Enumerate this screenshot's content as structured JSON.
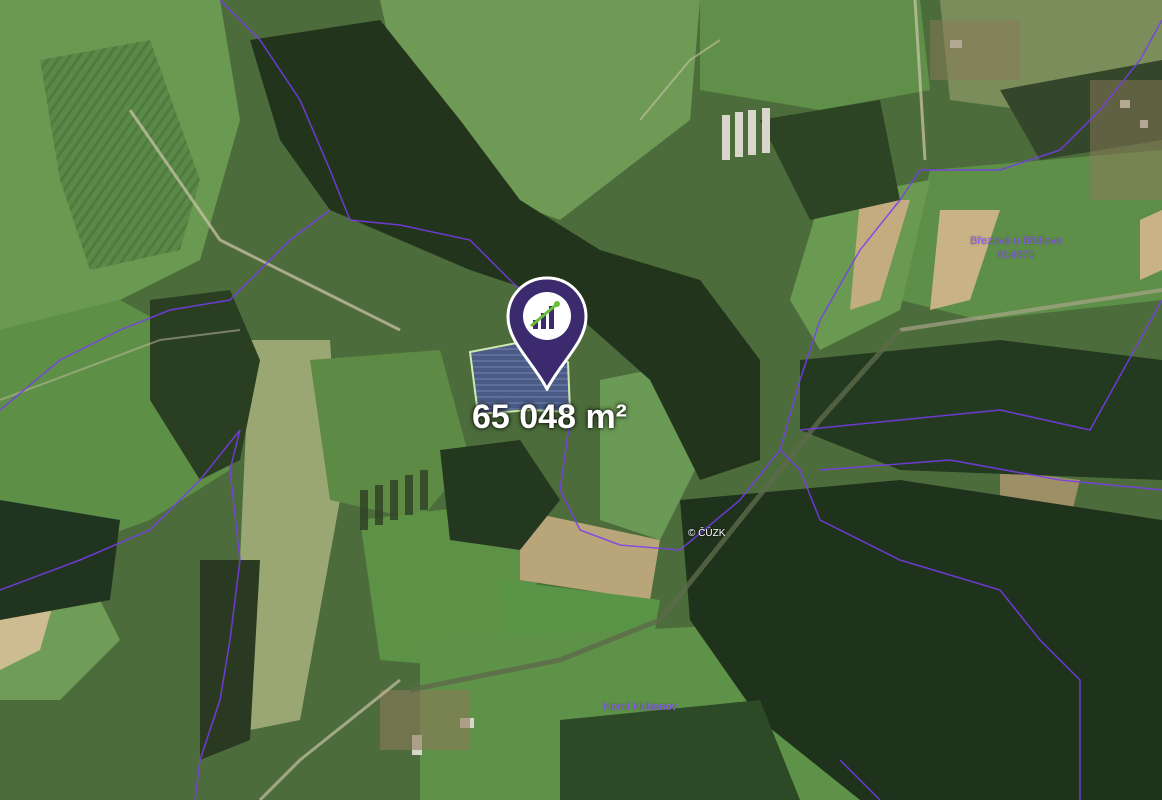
{
  "map": {
    "area_label": "65 048 m²",
    "place_labels": [
      {
        "name": "Březová u Břidlova",
        "code": "614670"
      },
      {
        "name": "Horní Hubenov",
        "code": ""
      }
    ],
    "attribution": "© ČÚZK",
    "marker_icon": "chart-bars-icon",
    "colors": {
      "boundary": "#7a3cf0",
      "parcel_outline": "#cfe9b0",
      "marker": "#3b2a6e",
      "label_text": "#ffffff",
      "place_text": "#8a5cf0"
    }
  }
}
